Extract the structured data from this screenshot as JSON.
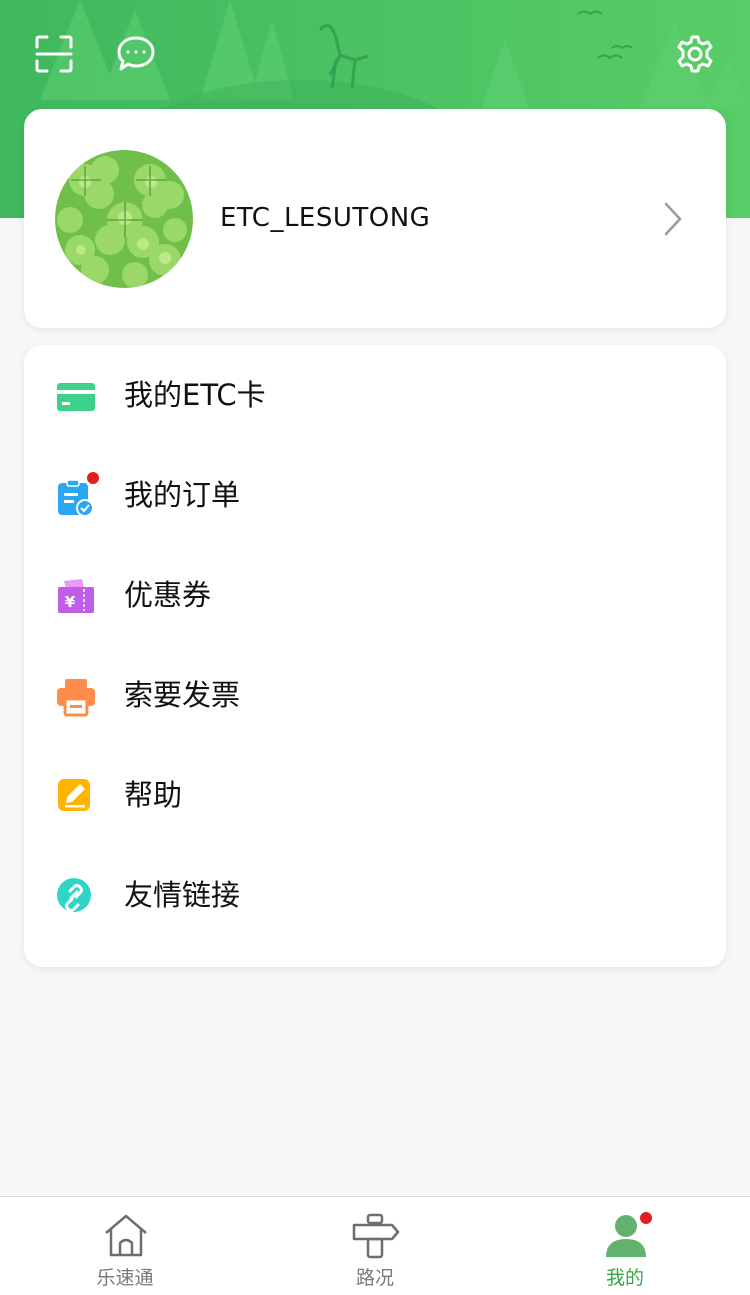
{
  "header": {
    "icons": [
      "scan-icon",
      "message-icon",
      "settings-gear-icon"
    ],
    "colors": {
      "banner": "#4cc463",
      "accent": "#3aa64a",
      "badge": "#e0201e"
    }
  },
  "profile": {
    "username": "ETC_LESUTONG",
    "avatar": "clover-avatar"
  },
  "menu": {
    "items": [
      {
        "label": "我的ETC卡",
        "icon": "etc-card-icon",
        "color": "#3fd08a",
        "badge": false
      },
      {
        "label": "我的订单",
        "icon": "order-clipboard-icon",
        "color": "#2aa7f2",
        "badge": true
      },
      {
        "label": "优惠券",
        "icon": "coupon-icon",
        "color": "#c15ee8",
        "badge": false
      },
      {
        "label": "索要发票",
        "icon": "printer-icon",
        "color": "#ff8c4a",
        "badge": false
      },
      {
        "label": "帮助",
        "icon": "help-pencil-icon",
        "color": "#ffb400",
        "badge": false
      },
      {
        "label": "友情链接",
        "icon": "link-icon",
        "color": "#2fd6c8",
        "badge": false
      }
    ]
  },
  "tabbar": {
    "tabs": [
      {
        "label": "乐速通",
        "icon": "home-icon",
        "active": false
      },
      {
        "label": "路况",
        "icon": "signpost-icon",
        "active": false
      },
      {
        "label": "我的",
        "icon": "user-icon",
        "active": true,
        "badge": true
      }
    ]
  }
}
